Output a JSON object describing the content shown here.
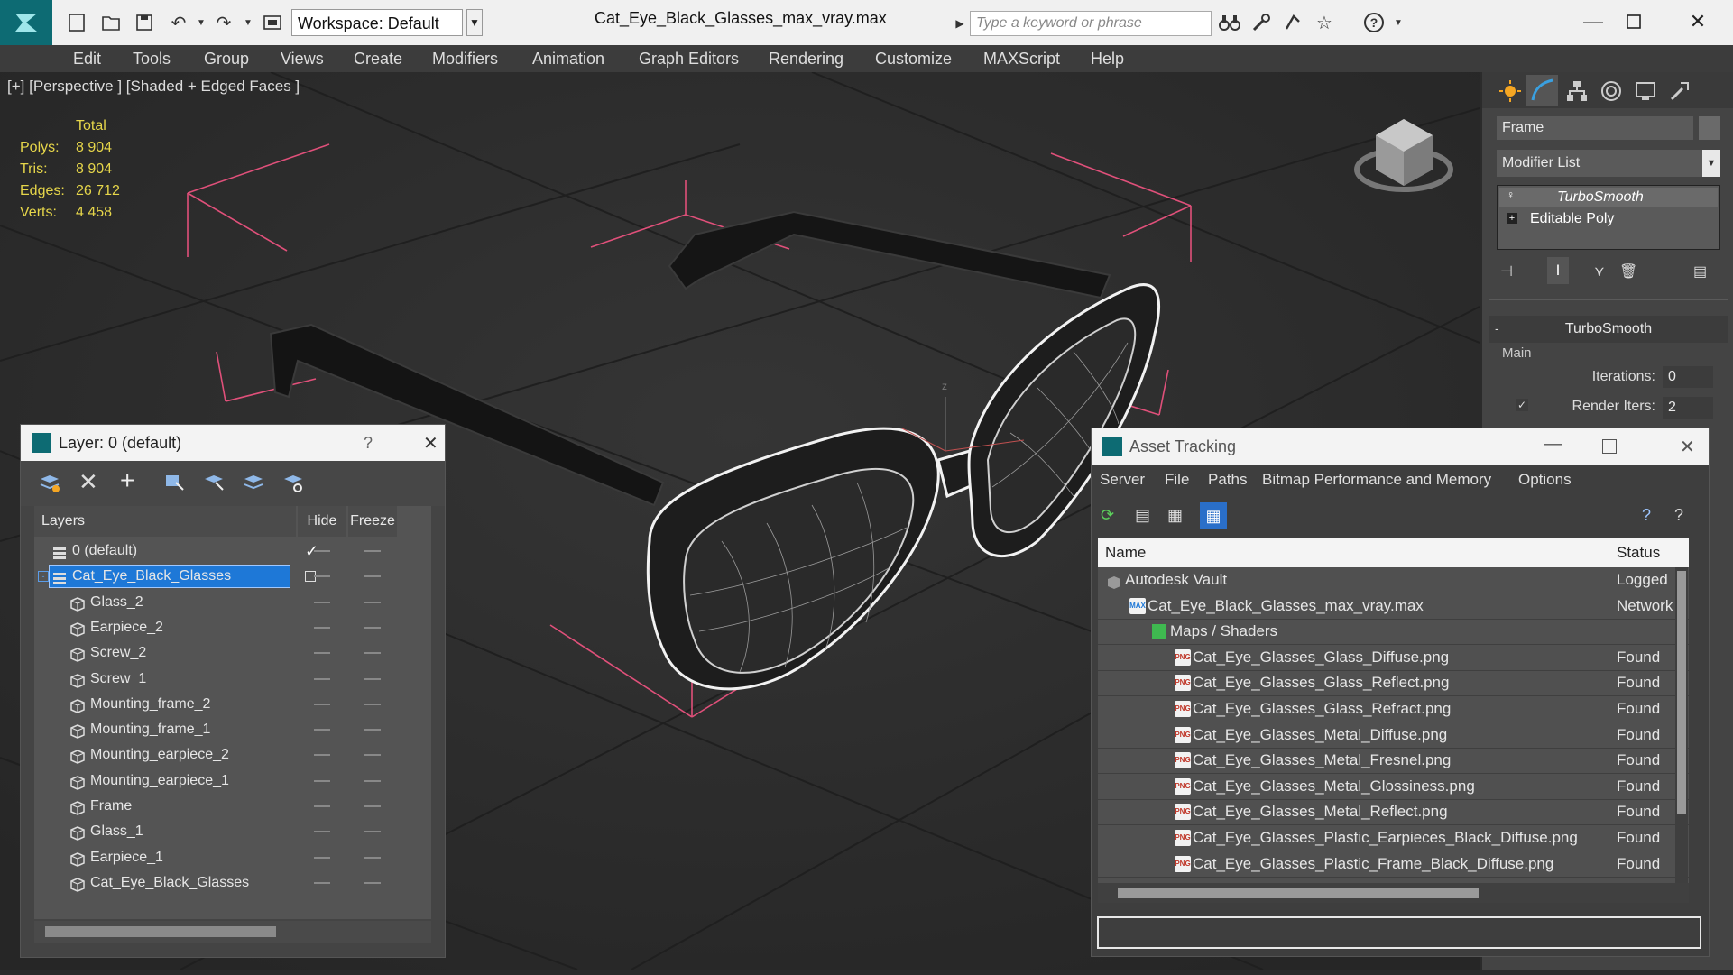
{
  "titlebar": {
    "workspace": "Workspace: Default",
    "title": "Cat_Eye_Black_Glasses_max_vray.max",
    "search_placeholder": "Type a keyword or phrase"
  },
  "menu": [
    "Edit",
    "Tools",
    "Group",
    "Views",
    "Create",
    "Modifiers",
    "Animation",
    "Graph Editors",
    "Rendering",
    "Customize",
    "MAXScript",
    "Help"
  ],
  "viewport": {
    "label": "[+] [Perspective ] [Shaded + Edged Faces ]",
    "stats_header": "Total",
    "stats": [
      {
        "label": "Polys:",
        "value": "8 904"
      },
      {
        "label": "Tris:",
        "value": "8 904"
      },
      {
        "label": "Edges:",
        "value": "26 712"
      },
      {
        "label": "Verts:",
        "value": "4 458"
      }
    ]
  },
  "command_panel": {
    "object_name": "Frame",
    "modifier_list": "Modifier List",
    "stack": [
      "TurboSmooth",
      "Editable Poly"
    ],
    "rollout_title": "TurboSmooth",
    "group_main": "Main",
    "iterations_label": "Iterations:",
    "iterations_value": "0",
    "render_iters_label": "Render Iters:",
    "render_iters_value": "2"
  },
  "layer_window": {
    "title": "Layer: 0 (default)",
    "help": "?",
    "col_layers": "Layers",
    "col_hide": "Hide",
    "col_freeze": "Freeze",
    "rows": [
      {
        "name": "0 (default)",
        "level": 0,
        "type": "layer"
      },
      {
        "name": "Cat_Eye_Black_Glasses",
        "level": 0,
        "type": "layer",
        "selected": true
      },
      {
        "name": "Glass_2",
        "level": 1,
        "type": "object"
      },
      {
        "name": "Earpiece_2",
        "level": 1,
        "type": "object"
      },
      {
        "name": "Screw_2",
        "level": 1,
        "type": "object"
      },
      {
        "name": "Screw_1",
        "level": 1,
        "type": "object"
      },
      {
        "name": "Mounting_frame_2",
        "level": 1,
        "type": "object"
      },
      {
        "name": "Mounting_frame_1",
        "level": 1,
        "type": "object"
      },
      {
        "name": "Mounting_earpiece_2",
        "level": 1,
        "type": "object"
      },
      {
        "name": "Mounting_earpiece_1",
        "level": 1,
        "type": "object"
      },
      {
        "name": "Frame",
        "level": 1,
        "type": "object"
      },
      {
        "name": "Glass_1",
        "level": 1,
        "type": "object"
      },
      {
        "name": "Earpiece_1",
        "level": 1,
        "type": "object"
      },
      {
        "name": "Cat_Eye_Black_Glasses",
        "level": 1,
        "type": "object"
      }
    ]
  },
  "asset_window": {
    "title": "Asset Tracking",
    "menu": [
      "Server",
      "File",
      "Paths",
      "Bitmap Performance and Memory",
      "Options"
    ],
    "col_name": "Name",
    "col_status": "Status",
    "rows": [
      {
        "name": "Autodesk Vault",
        "status": "Logged",
        "indent": 30,
        "icon": "vault"
      },
      {
        "name": "Cat_Eye_Black_Glasses_max_vray.max",
        "status": "Network",
        "indent": 55,
        "icon": "max"
      },
      {
        "name": "Maps / Shaders",
        "status": "",
        "indent": 80,
        "icon": "folder"
      },
      {
        "name": "Cat_Eye_Glasses_Glass_Diffuse.png",
        "status": "Found",
        "indent": 105,
        "icon": "png"
      },
      {
        "name": "Cat_Eye_Glasses_Glass_Reflect.png",
        "status": "Found",
        "indent": 105,
        "icon": "png"
      },
      {
        "name": "Cat_Eye_Glasses_Glass_Refract.png",
        "status": "Found",
        "indent": 105,
        "icon": "png"
      },
      {
        "name": "Cat_Eye_Glasses_Metal_Diffuse.png",
        "status": "Found",
        "indent": 105,
        "icon": "png"
      },
      {
        "name": "Cat_Eye_Glasses_Metal_Fresnel.png",
        "status": "Found",
        "indent": 105,
        "icon": "png"
      },
      {
        "name": "Cat_Eye_Glasses_Metal_Glossiness.png",
        "status": "Found",
        "indent": 105,
        "icon": "png"
      },
      {
        "name": "Cat_Eye_Glasses_Metal_Reflect.png",
        "status": "Found",
        "indent": 105,
        "icon": "png"
      },
      {
        "name": "Cat_Eye_Glasses_Plastic_Earpieces_Black_Diffuse.png",
        "status": "Found",
        "indent": 105,
        "icon": "png"
      },
      {
        "name": "Cat_Eye_Glasses_Plastic_Frame_Black_Diffuse.png",
        "status": "Found",
        "indent": 105,
        "icon": "png"
      }
    ]
  },
  "icons": {
    "png_badge": "PNG",
    "max_badge": "MAX"
  },
  "colors": {
    "accent": "#1e78d7",
    "stats": "#e6d64a",
    "bbox": "#e0507a",
    "logo": "#0d6b73"
  }
}
